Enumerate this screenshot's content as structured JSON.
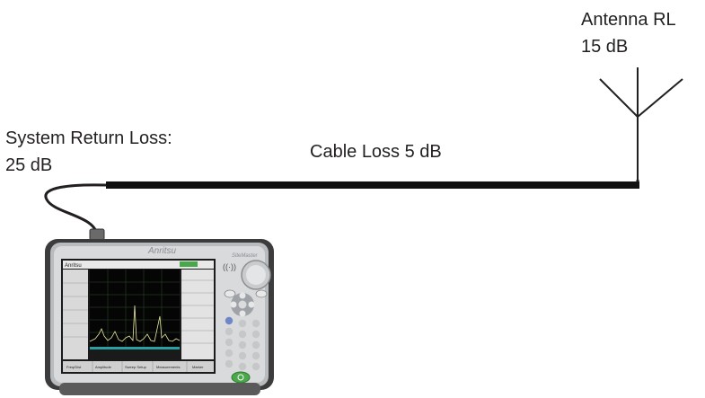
{
  "labels": {
    "antenna_line1": "Antenna RL",
    "antenna_line2": "15 dB",
    "system_line1": "System Return Loss:",
    "system_line2": "25 dB",
    "cable": "Cable Loss 5 dB"
  },
  "instrument": {
    "brand": "Anritsu",
    "model": "SiteMaster",
    "screen_header_brand": "Anritsu",
    "menu_tabs": [
      "Freq/Dist",
      "Amplitude",
      "Sweep Setup",
      "Measurements",
      "Marker"
    ]
  },
  "colors": {
    "cable": "#111111",
    "text": "#231f20",
    "screen_trace": "#e8e8a0",
    "key_blue": "#6f86c8",
    "key_green": "#4aa84a"
  }
}
